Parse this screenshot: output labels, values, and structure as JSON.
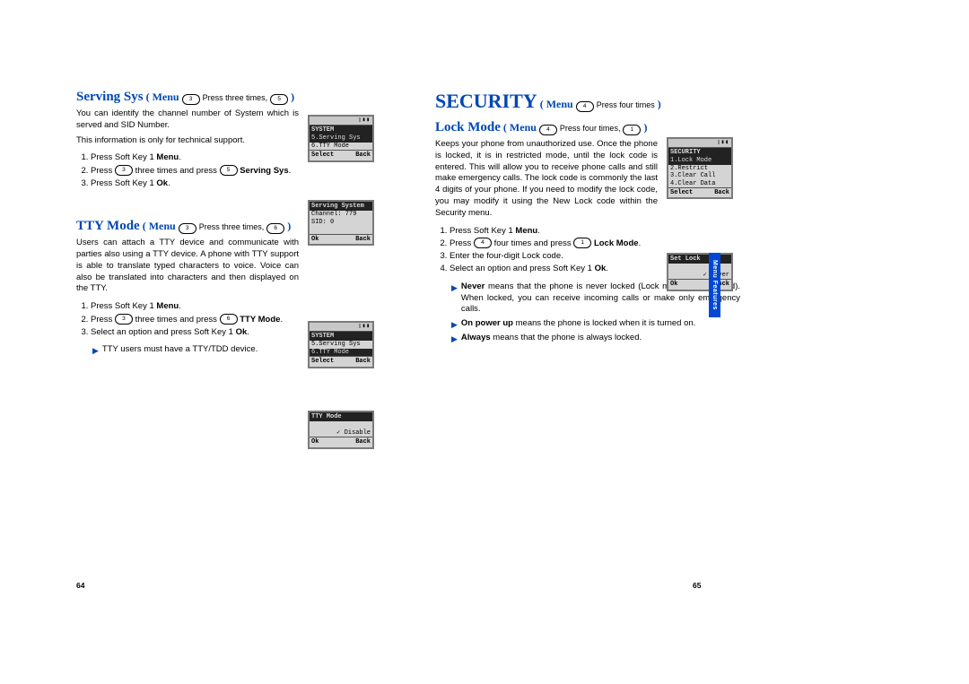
{
  "left": {
    "serving_sys": {
      "heading": "Serving Sys",
      "menu_paren_open": "( ",
      "menu_label": "Menu",
      "nav_suffix": "Press three times,",
      "close_paren": " )",
      "key1": "3",
      "key2": "5",
      "body1": "You can identify the channel number of System which is served and SID Number.",
      "body2": "This information is only for technical support.",
      "steps": {
        "s1_pre": "Press Soft Key 1 ",
        "s1_bold": "Menu",
        "s1_post": ".",
        "s2_pre": "Press ",
        "s2_mid": " three times and press ",
        "s2_bold": "Serving Sys",
        "s2_post": ".",
        "s3_pre": "Press Soft Key 1 ",
        "s3_bold": "Ok",
        "s3_post": "."
      },
      "lcd1": {
        "title": "SYSTEM",
        "row1": "5.Serving Sys",
        "row2": "6.TTY Mode",
        "foot_l": "Select",
        "foot_r": "Back"
      },
      "lcd2": {
        "title": "Serving System",
        "row1": "Channel: 779",
        "row2": "SID: 0",
        "foot_l": "Ok",
        "foot_r": "Back"
      }
    },
    "tty": {
      "heading": "TTY Mode",
      "menu_paren_open": "( ",
      "menu_label": "Menu",
      "nav_suffix": "Press three times,",
      "close_paren": " )",
      "key1": "3",
      "key2": "6",
      "body1": "Users can attach a TTY device and communicate with parties also using a TTY device. A phone with TTY support is able to translate typed characters to voice. Voice can also be translated into characters and then displayed on the TTY.",
      "steps": {
        "s1_pre": "Press Soft Key 1 ",
        "s1_bold": "Menu",
        "s1_post": ".",
        "s2_pre": "Press ",
        "s2_mid": " three times and press ",
        "s2_bold": "TTY Mode",
        "s2_post": ".",
        "s3": "Select an option and press Soft Key 1 ",
        "s3_bold": "Ok",
        "s3_post": "."
      },
      "note": "TTY users must have a TTY/TDD device.",
      "lcd1": {
        "title": "SYSTEM",
        "row1": "5.Serving Sys",
        "row2": "6.TTY Mode",
        "foot_l": "Select",
        "foot_r": "Back"
      },
      "lcd2": {
        "title": "TTY Mode",
        "row1": "✓ Disable",
        "foot_l": "Ok",
        "foot_r": "Back"
      }
    }
  },
  "right": {
    "security": {
      "heading": "SECURITY",
      "menu_paren_open": "( ",
      "menu_label": "Menu",
      "nav_suffix": "Press four times",
      "close_paren": ")",
      "key1": "4"
    },
    "lock": {
      "heading": "Lock Mode",
      "menu_paren_open": "( ",
      "menu_label": "Menu",
      "nav_suffix": "Press four times,",
      "close_paren": " )",
      "key1": "4",
      "key2": "1",
      "body1": "Keeps your phone from unauthorized use. Once the phone is locked, it is in restricted mode, until the lock code is entered. This will allow you to receive phone calls and still make emergency calls. The lock code is commonly the last 4 digits of your phone. If you need to modify the lock code, you may modify it using the New Lock code within the Security menu.",
      "steps": {
        "s1_pre": "Press Soft Key 1 ",
        "s1_bold": "Menu",
        "s1_post": ".",
        "s2_pre": "Press ",
        "s2_mid": " four times and press ",
        "s2_bold": "Lock Mode",
        "s2_post": ".",
        "s3": "Enter the four-digit Lock code.",
        "s4": "Select an option and press Soft Key 1 ",
        "s4_bold": "Ok",
        "s4_post": "."
      },
      "opts": {
        "never_lbl": "Never",
        "never_txt": " means that the phone is never locked (Lock mode can be used). When locked, you can receive incoming calls or make only emergency calls.",
        "power_lbl": "On power up",
        "power_txt": " means the phone is locked when it is turned on.",
        "always_lbl": "Always",
        "always_txt": " means that the phone is always locked."
      },
      "lcd1": {
        "title": "SECURITY",
        "row1": "1.Lock Mode",
        "row2": "2.Restrict",
        "row3": "3.Clear Call",
        "row4": "4.Clear Data",
        "foot_l": "Select",
        "foot_r": "Back"
      },
      "lcd2": {
        "title": "Set Lock",
        "row1": "✓ Never",
        "foot_l": "Ok",
        "foot_r": "Back"
      }
    }
  },
  "pagenum_left": "64",
  "pagenum_right": "65",
  "side_tab": "Menu Features"
}
